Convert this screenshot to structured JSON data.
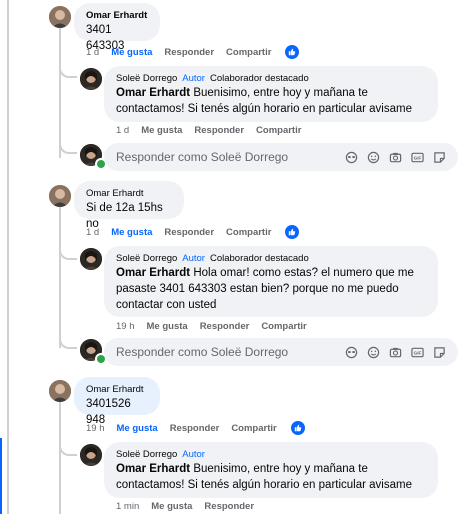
{
  "comment1": {
    "author": "Omar Erhardt",
    "text": "3401 643303",
    "time": "1 d",
    "like": "Me gusta",
    "reply": "Responder",
    "share": "Compartir"
  },
  "reply1": {
    "author": "Soleë Dorrego",
    "author_tag": "Autor",
    "badge": "Colaborador destacado",
    "mention": "Omar Erhardt",
    "text": " Buenisimo, entre hoy y mañana te contactamos! Si tenés algún horario en particular avisame",
    "time": "1 d",
    "like": "Me gusta",
    "reply": "Responder",
    "share": "Compartir"
  },
  "composer1": {
    "placeholder": "Responder como Soleë Dorrego"
  },
  "comment2": {
    "author": "Omar Erhardt",
    "text": "Si de 12a 15hs no",
    "time": "1 d",
    "like": "Me gusta",
    "reply": "Responder",
    "share": "Compartir"
  },
  "reply2": {
    "author": "Soleë Dorrego",
    "author_tag": "Autor",
    "badge": "Colaborador destacado",
    "mention": "Omar Erhardt",
    "text": " Hola omar! como estas? el numero que me pasaste 3401 643303 estan bien? porque no me puedo contactar con usted",
    "time": "19 h",
    "like": "Me gusta",
    "reply": "Responder",
    "share": "Compartir"
  },
  "composer2": {
    "placeholder": "Responder como Soleë Dorrego"
  },
  "comment3": {
    "author": "Omar Erhardt",
    "text": "3401526 948",
    "time": "19 h",
    "like": "Me gusta",
    "reply": "Responder",
    "share": "Compartir"
  },
  "reply3": {
    "author": "Soleë Dorrego",
    "author_tag": "Autor",
    "mention": "Omar Erhardt",
    "text": " Buenisimo, entre hoy y mañana te contactamos! Si tenés algún horario en particular avisame",
    "time": "1 min",
    "like": "Me gusta",
    "reply": "Responder"
  },
  "icons": {
    "like": "thumbs-up-icon",
    "avatar_sticker": "avatar-sticker-icon",
    "emoji": "emoji-icon",
    "camera": "camera-icon",
    "gif": "gif-icon",
    "sticker": "sticker-icon"
  },
  "colors": {
    "accent": "#0866ff",
    "bubble": "#f0f2f5",
    "muted": "#65676b"
  }
}
